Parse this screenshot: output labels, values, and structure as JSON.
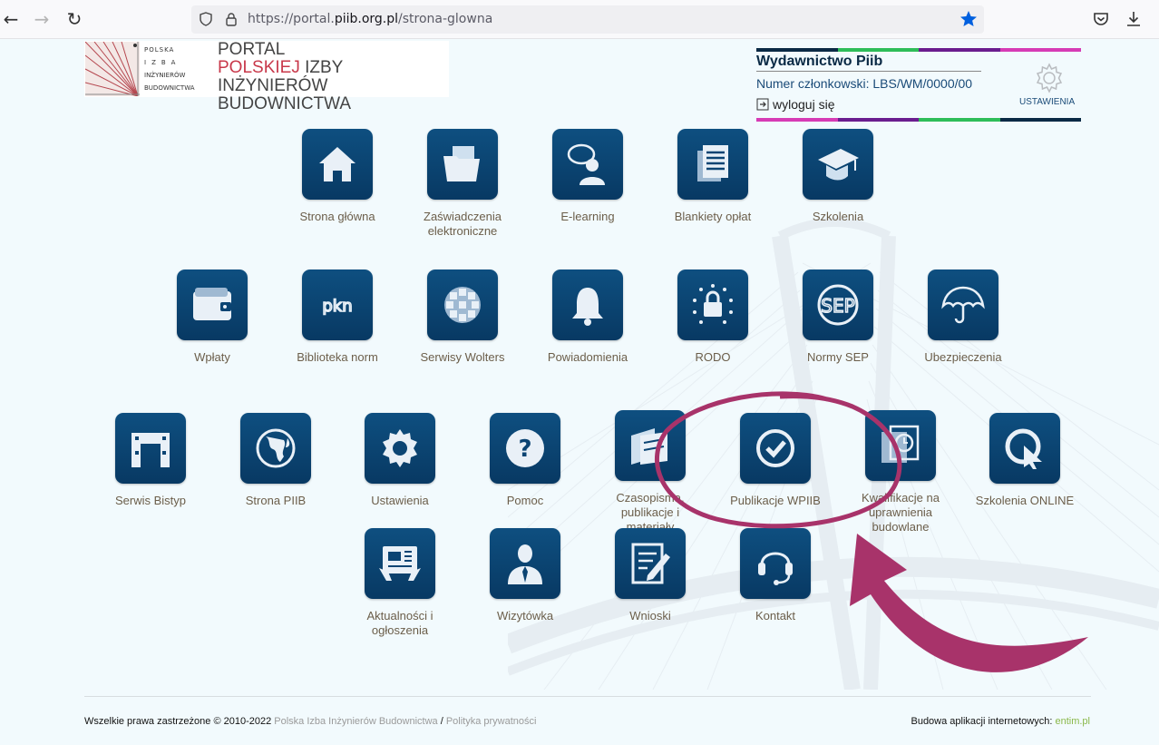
{
  "browser": {
    "url_prefix": "https://portal.",
    "url_domain": "piib.org.pl",
    "url_path": "/strona-glowna"
  },
  "logo": {
    "letters": [
      "POLSKA",
      "IZBA",
      "INŻYNIERÓW",
      "BUDOWNICTWA"
    ],
    "title_line1": "PORTAL",
    "title_red": "POLSKIEJ",
    "title_rest": " IZBY INŻYNIERÓW",
    "title_line3": "BUDOWNICTWA"
  },
  "user": {
    "name": "Wydawnictwo Piib",
    "member_number": "Numer członkowski: LBS/WM/0000/00",
    "logout": "wyloguj się",
    "settings": "USTAWIENIA"
  },
  "colors": {
    "stripe": [
      "#0a2a45",
      "#2ebd59",
      "#6a1d8f",
      "#d63bb5"
    ],
    "tile": "#0a4470",
    "annotation": "#a8336a"
  },
  "tiles": [
    {
      "label": "Strona główna",
      "icon": "house-icon"
    },
    {
      "label": "Zaświadczenia elektroniczne",
      "icon": "folder-icon"
    },
    {
      "label": "E-learning",
      "icon": "person-speech-icon"
    },
    {
      "label": "Blankiety opłat",
      "icon": "documents-icon"
    },
    {
      "label": "Szkolenia",
      "icon": "graduation-cap-icon"
    },
    {
      "label": "Wpłaty",
      "icon": "wallet-icon"
    },
    {
      "label": "Biblioteka norm",
      "icon": "pkn-icon"
    },
    {
      "label": "Serwisy Wolters",
      "icon": "globe-grid-icon"
    },
    {
      "label": "Powiadomienia",
      "icon": "bell-icon"
    },
    {
      "label": "RODO",
      "icon": "lock-stars-icon"
    },
    {
      "label": "Normy SEP",
      "icon": "sep-icon"
    },
    {
      "label": "Ubezpieczenia",
      "icon": "umbrella-icon"
    },
    {
      "label": "Serwis Bistyp",
      "icon": "bistyp-icon"
    },
    {
      "label": "Strona PIIB",
      "icon": "globe-icon"
    },
    {
      "label": "Ustawienia",
      "icon": "gear-icon"
    },
    {
      "label": "Pomoc",
      "icon": "question-icon"
    },
    {
      "label": "Czasopisma, publikacje i materiały",
      "icon": "magazine-icon"
    },
    {
      "label": "Publikacje WPIIB",
      "icon": "check-circle-icon"
    },
    {
      "label": "Kwalifikacje na uprawnienia budowlane",
      "icon": "clock-docs-icon"
    },
    {
      "label": "Szkolenia ONLINE",
      "icon": "online-cursor-icon"
    },
    {
      "label": "Aktualności i ogłoszenia",
      "icon": "news-icon"
    },
    {
      "label": "Wizytówka",
      "icon": "businessman-icon"
    },
    {
      "label": "Wnioski",
      "icon": "form-pen-icon"
    },
    {
      "label": "Kontakt",
      "icon": "headset-icon"
    }
  ],
  "footer": {
    "copyright": "Wszelkie prawa zastrzeżone © 2010-2022 ",
    "link1": "Polska Izba Inżynierów Budownictwa",
    "sep": " / ",
    "link2": "Polityka prywatności",
    "built_by": "Budowa aplikacji internetowych: ",
    "built_link": "entim.pl"
  }
}
